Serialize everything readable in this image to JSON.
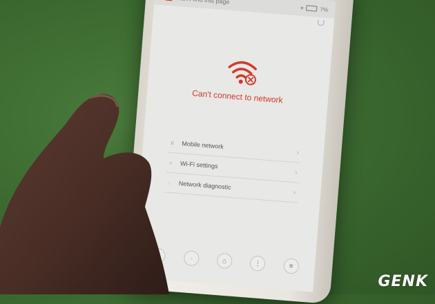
{
  "statusbar": {
    "title": "Can't find this page",
    "battery": "7%"
  },
  "error": {
    "message": "Can't connect to network",
    "accent_color": "#d23a2a",
    "icon": "wifi-error-icon"
  },
  "menu": {
    "items": [
      {
        "label": "Mobile network",
        "icon": "signal-icon"
      },
      {
        "label": "Wi-Fi settings",
        "icon": "circle-icon"
      },
      {
        "label": "Network diagnostic",
        "icon": "diagnostic-icon"
      }
    ]
  },
  "navbar": {
    "back": "‹",
    "forward": "›",
    "home": "⌂",
    "menu_dots": "⋮",
    "tabs": "≡"
  },
  "watermark": {
    "text": "GENK"
  }
}
